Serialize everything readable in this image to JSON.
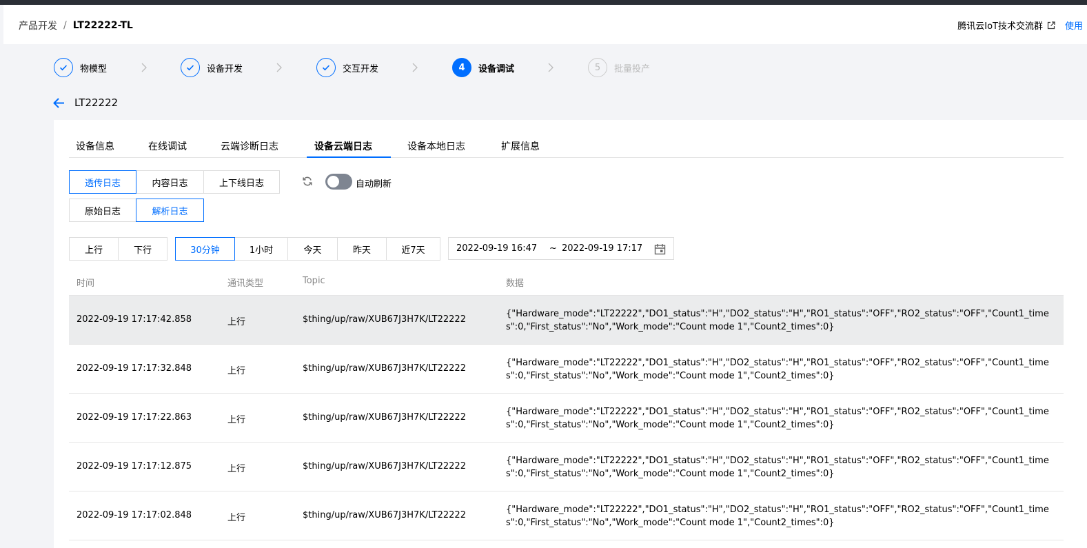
{
  "header": {
    "breadcrumb_parent": "产品开发",
    "breadcrumb_sep": "/",
    "breadcrumb_current": "LT22222-TL",
    "community_link": "腾讯云IoT技术交流群",
    "use_link": "使用"
  },
  "steps": [
    {
      "label": "物模型",
      "state": "done",
      "icon": "check-icon"
    },
    {
      "label": "设备开发",
      "state": "done",
      "icon": "check-icon"
    },
    {
      "label": "交互开发",
      "state": "done",
      "icon": "check-icon"
    },
    {
      "label": "设备调试",
      "state": "active",
      "number": "4"
    },
    {
      "label": "批量投产",
      "state": "disabled",
      "number": "5"
    }
  ],
  "device": {
    "name": "LT22222"
  },
  "tabs": [
    {
      "label": "设备信息"
    },
    {
      "label": "在线调试"
    },
    {
      "label": "云端诊断日志"
    },
    {
      "label": "设备云端日志",
      "active": true
    },
    {
      "label": "设备本地日志"
    },
    {
      "label": "扩展信息"
    }
  ],
  "log_type": [
    "透传日志",
    "内容日志",
    "上下线日志"
  ],
  "log_format": [
    "原始日志",
    "解析日志"
  ],
  "auto_refresh": {
    "label": "自动刷新",
    "on": false
  },
  "direction": [
    "上行",
    "下行"
  ],
  "time_range": [
    "30分钟",
    "1小时",
    "今天",
    "昨天",
    "近7天"
  ],
  "date_range": {
    "start": "2022-09-19 16:47",
    "sep": "~",
    "end": "2022-09-19 17:17"
  },
  "table": {
    "columns": [
      "时间",
      "通讯类型",
      "Topic",
      "数据"
    ],
    "rows": [
      {
        "time": "2022-09-19 17:17:42.858",
        "type": "上行",
        "topic": "$thing/up/raw/XUB67J3H7K/LT22222",
        "data": "{\"Hardware_mode\":\"LT22222\",\"DO1_status\":\"H\",\"DO2_status\":\"H\",\"RO1_status\":\"OFF\",\"RO2_status\":\"OFF\",\"Count1_times\":0,\"First_status\":\"No\",\"Work_mode\":\"Count mode 1\",\"Count2_times\":0}"
      },
      {
        "time": "2022-09-19 17:17:32.848",
        "type": "上行",
        "topic": "$thing/up/raw/XUB67J3H7K/LT22222",
        "data": "{\"Hardware_mode\":\"LT22222\",\"DO1_status\":\"H\",\"DO2_status\":\"H\",\"RO1_status\":\"OFF\",\"RO2_status\":\"OFF\",\"Count1_times\":0,\"First_status\":\"No\",\"Work_mode\":\"Count mode 1\",\"Count2_times\":0}"
      },
      {
        "time": "2022-09-19 17:17:22.863",
        "type": "上行",
        "topic": "$thing/up/raw/XUB67J3H7K/LT22222",
        "data": "{\"Hardware_mode\":\"LT22222\",\"DO1_status\":\"H\",\"DO2_status\":\"H\",\"RO1_status\":\"OFF\",\"RO2_status\":\"OFF\",\"Count1_times\":0,\"First_status\":\"No\",\"Work_mode\":\"Count mode 1\",\"Count2_times\":0}"
      },
      {
        "time": "2022-09-19 17:17:12.875",
        "type": "上行",
        "topic": "$thing/up/raw/XUB67J3H7K/LT22222",
        "data": "{\"Hardware_mode\":\"LT22222\",\"DO1_status\":\"H\",\"DO2_status\":\"H\",\"RO1_status\":\"OFF\",\"RO2_status\":\"OFF\",\"Count1_times\":0,\"First_status\":\"No\",\"Work_mode\":\"Count mode 1\",\"Count2_times\":0}"
      },
      {
        "time": "2022-09-19 17:17:02.848",
        "type": "上行",
        "topic": "$thing/up/raw/XUB67J3H7K/LT22222",
        "data": "{\"Hardware_mode\":\"LT22222\",\"DO1_status\":\"H\",\"DO2_status\":\"H\",\"RO1_status\":\"OFF\",\"RO2_status\":\"OFF\",\"Count1_times\":0,\"First_status\":\"No\",\"Work_mode\":\"Count mode 1\",\"Count2_times\":0}"
      }
    ]
  },
  "colors": {
    "accent": "#006eff",
    "topbar": "#2b2f36",
    "row_highlight": "#ebeced"
  }
}
